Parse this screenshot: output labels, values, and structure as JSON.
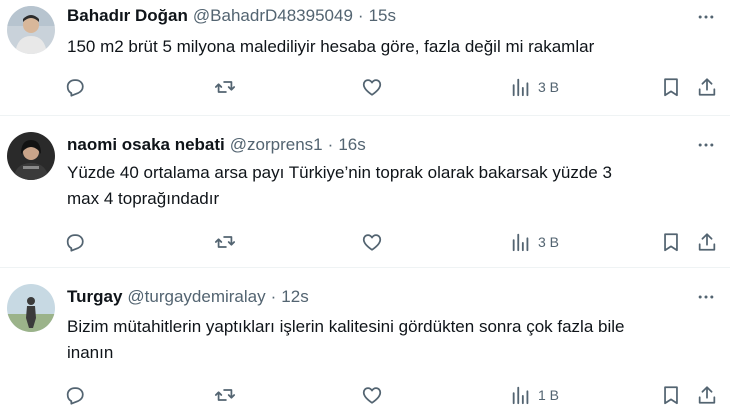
{
  "tweets": [
    {
      "name": "Bahadır Doğan",
      "handle": "@BahadrD48395049",
      "separator": "·",
      "time": "15s",
      "text": "150 m2 brüt 5 milyona malediliyir hesaba göre, fazla değil mi rakamlar",
      "views": "3 B",
      "avatar_colors": {
        "bg": "#c9d2da",
        "skin": "#d8b79a",
        "shirt": "#e8e8e8",
        "hair": "#2b2b2b"
      }
    },
    {
      "name": "naomi osaka nebati",
      "handle": "@zorprens1",
      "separator": "·",
      "time": "16s",
      "text_lines": [
        "Yüzde 40  ortalama arsa payı Türkiye’nin toprak olarak bakarsak yüzde 3",
        "max 4 toprağındadır"
      ],
      "views": "3 B",
      "avatar_colors": {
        "bg": "#2a2a2a",
        "skin": "#c9a48a",
        "shirt": "#3a3a3a",
        "hair": "#121212"
      }
    },
    {
      "name": "Turgay",
      "handle": "@turgaydemiralay",
      "separator": "·",
      "time": "12s",
      "text_lines": [
        "Bizim mütahitlerin yaptıkları işlerin kalitesini gördükten sonra çok fazla bile",
        "inanın"
      ],
      "views": "1 B",
      "avatar_colors": {
        "bg": "#c7d9e3",
        "ground": "#9bb38a",
        "figure": "#3b3b3b"
      }
    }
  ],
  "icons": {
    "more": "more-horizontal-icon",
    "reply": "reply-icon",
    "retweet": "retweet-icon",
    "like": "like-heart-icon",
    "views": "views-analytics-icon",
    "bookmark": "bookmark-icon",
    "share": "share-icon"
  },
  "colors": {
    "icon": "#536471",
    "text": "#0f1419",
    "muted": "#536471",
    "divider": "#eff3f4"
  }
}
